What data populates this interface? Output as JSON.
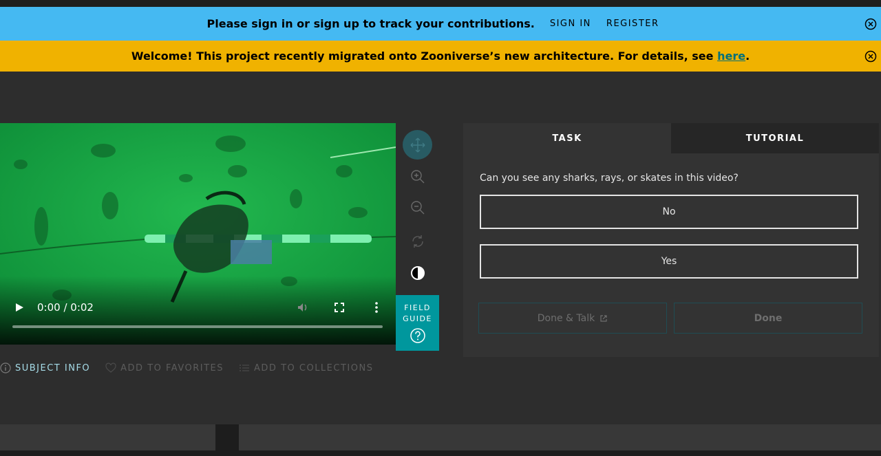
{
  "banners": {
    "signin": {
      "message": "Please sign in or sign up to track your contributions.",
      "sign_in": "SIGN IN",
      "register": "REGISTER"
    },
    "migration": {
      "message": "Welcome! This project recently migrated onto Zooniverse’s new architecture. For details, see ",
      "link": "here",
      "suffix": "."
    }
  },
  "video": {
    "time": "0:00 / 0:02",
    "progress": 0.0
  },
  "toolbar": {
    "field_guide_line1": "FIELD",
    "field_guide_line2": "GUIDE"
  },
  "meta": {
    "subject_info": "SUBJECT INFO",
    "favorites": "ADD TO FAVORITES",
    "collections": "ADD TO COLLECTIONS"
  },
  "panel": {
    "tabs": [
      {
        "label": "TASK",
        "active": true
      },
      {
        "label": "TUTORIAL",
        "active": false
      }
    ],
    "question": "Can you see any sharks, rays, or skates in this video?",
    "answers": [
      "No",
      "Yes"
    ],
    "done_talk": "Done & Talk",
    "done": "Done"
  },
  "colors": {
    "banner_blue": "#45b9f2",
    "banner_yellow": "#f0b200",
    "teal": "#00979d",
    "background": "#2d2d2d"
  }
}
